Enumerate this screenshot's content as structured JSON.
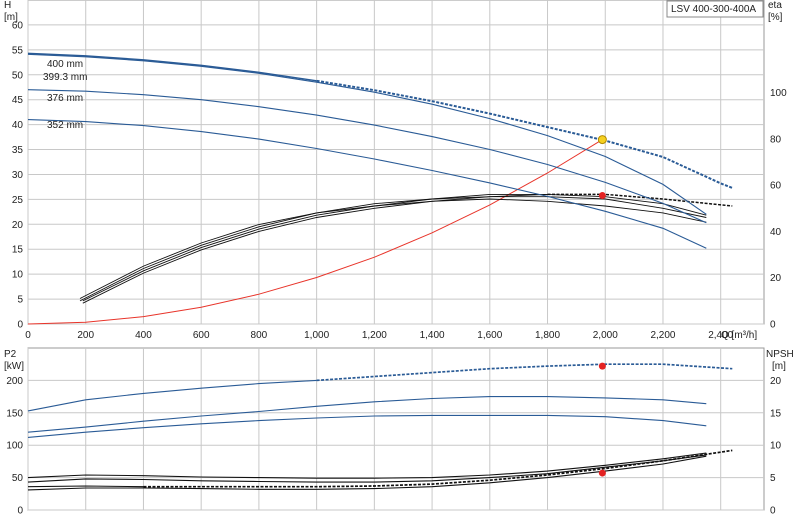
{
  "chart_data": [
    {
      "type": "line",
      "title": "LSV 400-300-400A",
      "xlabel": "Q [m³/h]",
      "x_ticks": [
        "0",
        "200",
        "400",
        "600",
        "800",
        "1,000",
        "1,200",
        "1,400",
        "1,600",
        "1,800",
        "2,000",
        "2,200",
        "2,400"
      ],
      "xlim": [
        0,
        2550
      ],
      "ylabel_left": "H",
      "ylabel_left_unit": "[m]",
      "ylim_left": [
        0,
        65
      ],
      "y_ticks_left": [
        0,
        5,
        10,
        15,
        20,
        25,
        30,
        35,
        40,
        45,
        50,
        55,
        60
      ],
      "ylabel_right": "eta",
      "ylabel_right_unit": "[%]",
      "ylim_right": [
        0,
        140
      ],
      "y_ticks_right": [
        0,
        20,
        40,
        60,
        80,
        100
      ],
      "grid": true,
      "head_curves": [
        {
          "label": "400 mm",
          "x": [
            0,
            200,
            400,
            600,
            800,
            1000,
            1200,
            1400,
            1600,
            1800,
            2000,
            2200,
            2400,
            2440
          ],
          "y": [
            54.3,
            53.8,
            53.0,
            51.9,
            50.5,
            48.8,
            46.9,
            44.7,
            42.2,
            39.5,
            36.8,
            33.5,
            28.2,
            27.3
          ],
          "dashed_from": 1000
        },
        {
          "label": "399.3 mm",
          "x": [
            0,
            200,
            400,
            600,
            800,
            1000,
            1200,
            1400,
            1600,
            1800,
            2000,
            2200,
            2350
          ],
          "y": [
            54.1,
            53.6,
            52.8,
            51.7,
            50.3,
            48.5,
            46.5,
            44.1,
            41.2,
            37.8,
            33.6,
            28.0,
            22.0
          ]
        },
        {
          "label": "376 mm",
          "x": [
            0,
            200,
            400,
            600,
            800,
            1000,
            1200,
            1400,
            1600,
            1800,
            2000,
            2200,
            2350
          ],
          "y": [
            47.0,
            46.7,
            46.0,
            45.0,
            43.6,
            41.9,
            39.9,
            37.6,
            35.0,
            32.0,
            28.4,
            24.2,
            20.3
          ]
        },
        {
          "label": "352 mm",
          "x": [
            0,
            200,
            400,
            600,
            800,
            1000,
            1200,
            1400,
            1600,
            1800,
            2000,
            2200,
            2350
          ],
          "y": [
            41.0,
            40.6,
            39.8,
            38.6,
            37.1,
            35.2,
            33.1,
            30.8,
            28.3,
            25.6,
            22.6,
            19.2,
            15.2
          ]
        }
      ],
      "system_curve": {
        "x": [
          0,
          200,
          400,
          600,
          800,
          1000,
          1200,
          1400,
          1600,
          1800,
          1990
        ],
        "y": [
          0,
          0.37,
          1.49,
          3.36,
          5.97,
          9.33,
          13.4,
          18.3,
          23.9,
          30.3,
          37.0
        ]
      },
      "duty_point": {
        "x": 1990,
        "y": 37.0
      },
      "eta_curves": [
        {
          "x": [
            190,
            400,
            600,
            800,
            1000,
            1200,
            1400,
            1600,
            1800,
            2000,
            2200,
            2440
          ],
          "y": [
            9,
            22,
            32,
            40,
            46,
            50,
            53,
            55,
            56,
            56,
            54,
            51
          ],
          "dashed_from": 1800
        },
        {
          "x": [
            190,
            400,
            600,
            800,
            1000,
            1200,
            1400,
            1600,
            1800,
            2000,
            2200,
            2350
          ],
          "y": [
            10,
            23,
            33,
            41,
            47,
            51,
            54,
            56,
            56,
            55,
            52,
            47
          ]
        },
        {
          "x": [
            180,
            400,
            600,
            800,
            1000,
            1200,
            1400,
            1600,
            1800,
            2000,
            2200,
            2350
          ],
          "y": [
            10,
            24,
            34,
            42,
            48,
            52,
            54,
            55,
            55,
            54,
            50,
            46
          ]
        },
        {
          "x": [
            180,
            400,
            600,
            800,
            1000,
            1200,
            1400,
            1600,
            1800,
            2000,
            2200,
            2350
          ],
          "y": [
            11,
            25,
            35,
            43,
            48,
            51,
            53,
            54,
            53,
            51,
            48,
            44
          ]
        }
      ],
      "eta_point": {
        "x": 1990,
        "y": 55.5
      }
    },
    {
      "type": "line",
      "ylabel_left": "P2",
      "ylabel_left_unit": "[kW]",
      "ylim_left": [
        0,
        250
      ],
      "y_ticks_left": [
        0,
        50,
        100,
        150,
        200
      ],
      "ylabel_right": "NPSH",
      "ylabel_right_unit": "[m]",
      "ylim_right": [
        0,
        25
      ],
      "y_ticks_right": [
        0,
        5,
        10,
        15,
        20
      ],
      "xlim": [
        0,
        2550
      ],
      "grid": true,
      "power_curves": [
        {
          "x": [
            0,
            200,
            400,
            600,
            800,
            1000,
            1200,
            1400,
            1600,
            1800,
            2000,
            2200,
            2440
          ],
          "y": [
            153,
            170,
            180,
            188,
            195,
            200,
            206,
            212,
            218,
            222,
            225,
            225,
            218
          ],
          "dashed_from": 1000
        },
        {
          "x": [
            0,
            200,
            400,
            600,
            800,
            1000,
            1200,
            1400,
            1600,
            1800,
            2000,
            2200,
            2350
          ],
          "y": [
            120,
            128,
            137,
            145,
            152,
            160,
            167,
            172,
            175,
            175,
            173,
            170,
            164
          ]
        },
        {
          "x": [
            0,
            200,
            400,
            600,
            800,
            1000,
            1200,
            1400,
            1600,
            1800,
            2000,
            2200,
            2350
          ],
          "y": [
            112,
            120,
            127,
            133,
            138,
            142,
            145,
            146,
            146,
            146,
            144,
            138,
            130
          ]
        }
      ],
      "power_point": {
        "x": 1990,
        "y": 222
      },
      "npsh_curves": [
        {
          "x": [
            0,
            200,
            400,
            600,
            800,
            1000,
            1200,
            1400,
            1600,
            1800,
            2000,
            2200,
            2440
          ],
          "y": [
            3.6,
            3.7,
            3.6,
            3.6,
            3.6,
            3.6,
            3.7,
            4.0,
            4.6,
            5.4,
            6.4,
            7.6,
            9.2
          ],
          "dashed_from": 400
        },
        {
          "x": [
            0,
            200,
            400,
            600,
            800,
            1000,
            1200,
            1400,
            1600,
            1800,
            2000,
            2200,
            2350
          ],
          "y": [
            5.0,
            5.4,
            5.3,
            5.1,
            5.0,
            4.9,
            4.9,
            5.0,
            5.4,
            6.0,
            6.9,
            7.9,
            8.8
          ]
        },
        {
          "x": [
            0,
            200,
            400,
            600,
            800,
            1000,
            1200,
            1400,
            1600,
            1800,
            2000,
            2200,
            2350
          ],
          "y": [
            4.3,
            4.8,
            4.7,
            4.5,
            4.4,
            4.3,
            4.3,
            4.5,
            5.0,
            5.6,
            6.6,
            7.6,
            8.5
          ]
        },
        {
          "x": [
            0,
            200,
            400,
            600,
            800,
            1000,
            1200,
            1400,
            1600,
            1800,
            2000,
            2200,
            2350
          ],
          "y": [
            3.1,
            3.4,
            3.4,
            3.3,
            3.2,
            3.2,
            3.3,
            3.6,
            4.2,
            5.0,
            6.0,
            7.1,
            8.3
          ]
        }
      ],
      "npsh_point": {
        "x": 1990,
        "y": 5.7
      }
    }
  ],
  "colors": {
    "head": "#2a5b96",
    "system": "#e8342a",
    "eta": "#111111",
    "duty_point_fill": "#f5d020",
    "point_fill": "#e32222",
    "grid": "#c8c8c8"
  }
}
